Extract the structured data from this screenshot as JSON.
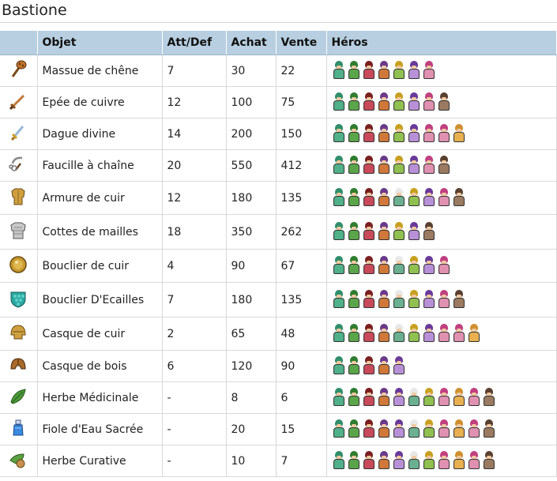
{
  "page": {
    "title": "Bastione"
  },
  "table": {
    "headers": [
      "",
      "Objet",
      "Att/Def",
      "Achat",
      "Vente",
      "Héros"
    ],
    "rows": [
      {
        "icon": "club-icon",
        "name": "Massue de chêne",
        "attdef": "7",
        "achat": "30",
        "vente": "22",
        "heroes": [
          "teal",
          "green",
          "red",
          "orange",
          "yellow",
          "purple",
          "pink"
        ]
      },
      {
        "icon": "copper-sword-icon",
        "name": "Epée de cuivre",
        "attdef": "12",
        "achat": "100",
        "vente": "75",
        "heroes": [
          "teal",
          "green",
          "red",
          "orange",
          "yellow",
          "purple",
          "pink",
          "brown"
        ]
      },
      {
        "icon": "dagger-icon",
        "name": "Dague divine",
        "attdef": "14",
        "achat": "200",
        "vente": "150",
        "heroes": [
          "teal",
          "green",
          "red",
          "orange",
          "yellow",
          "purple",
          "pink",
          "pink",
          "gold"
        ]
      },
      {
        "icon": "chain-sickle-icon",
        "name": "Faucille à chaîne",
        "attdef": "20",
        "achat": "550",
        "vente": "412",
        "heroes": [
          "teal",
          "green",
          "red",
          "orange",
          "yellow",
          "purple",
          "pink",
          "brown"
        ]
      },
      {
        "icon": "leather-armor-icon",
        "name": "Armure de cuir",
        "attdef": "12",
        "achat": "180",
        "vente": "135",
        "heroes": [
          "teal",
          "green",
          "red",
          "orange",
          "mint",
          "yellow",
          "purple",
          "pink",
          "brown"
        ]
      },
      {
        "icon": "chainmail-icon",
        "name": "Cottes de mailles",
        "attdef": "18",
        "achat": "350",
        "vente": "262",
        "heroes": [
          "teal",
          "green",
          "red",
          "orange",
          "yellow",
          "purple",
          "brown"
        ]
      },
      {
        "icon": "leather-shield-icon",
        "name": "Bouclier de cuir",
        "attdef": "4",
        "achat": "90",
        "vente": "67",
        "heroes": [
          "teal",
          "green",
          "red",
          "orange",
          "mint",
          "yellow",
          "purple",
          "pink"
        ]
      },
      {
        "icon": "scale-shield-icon",
        "name": "Bouclier D'Ecailles",
        "attdef": "7",
        "achat": "180",
        "vente": "135",
        "heroes": [
          "teal",
          "green",
          "red",
          "orange",
          "mint",
          "yellow",
          "purple",
          "pink",
          "brown"
        ]
      },
      {
        "icon": "leather-helmet-icon",
        "name": "Casque de cuir",
        "attdef": "2",
        "achat": "65",
        "vente": "48",
        "heroes": [
          "teal",
          "green",
          "red",
          "orange",
          "mint",
          "yellow",
          "purple",
          "pink",
          "pink",
          "gold"
        ]
      },
      {
        "icon": "wooden-helmet-icon",
        "name": "Casque de bois",
        "attdef": "6",
        "achat": "120",
        "vente": "90",
        "heroes": [
          "teal",
          "green",
          "red",
          "orange",
          "purple"
        ]
      },
      {
        "icon": "medicinal-herb-icon",
        "name": "Herbe Médicinale",
        "attdef": "-",
        "achat": "8",
        "vente": "6",
        "heroes": [
          "teal",
          "green",
          "red",
          "orange",
          "purple",
          "mint",
          "yellow",
          "pink",
          "gold",
          "pink",
          "brown"
        ]
      },
      {
        "icon": "holy-water-icon",
        "name": "Fiole d'Eau Sacrée",
        "attdef": "-",
        "achat": "20",
        "vente": "15",
        "heroes": [
          "teal",
          "green",
          "red",
          "orange",
          "purple",
          "mint",
          "yellow",
          "pink",
          "gold",
          "pink",
          "brown"
        ]
      },
      {
        "icon": "curative-herb-icon",
        "name": "Herbe Curative",
        "attdef": "-",
        "achat": "10",
        "vente": "7",
        "heroes": [
          "teal",
          "green",
          "red",
          "orange",
          "purple",
          "mint",
          "yellow",
          "pink",
          "gold",
          "pink",
          "brown"
        ]
      }
    ]
  }
}
